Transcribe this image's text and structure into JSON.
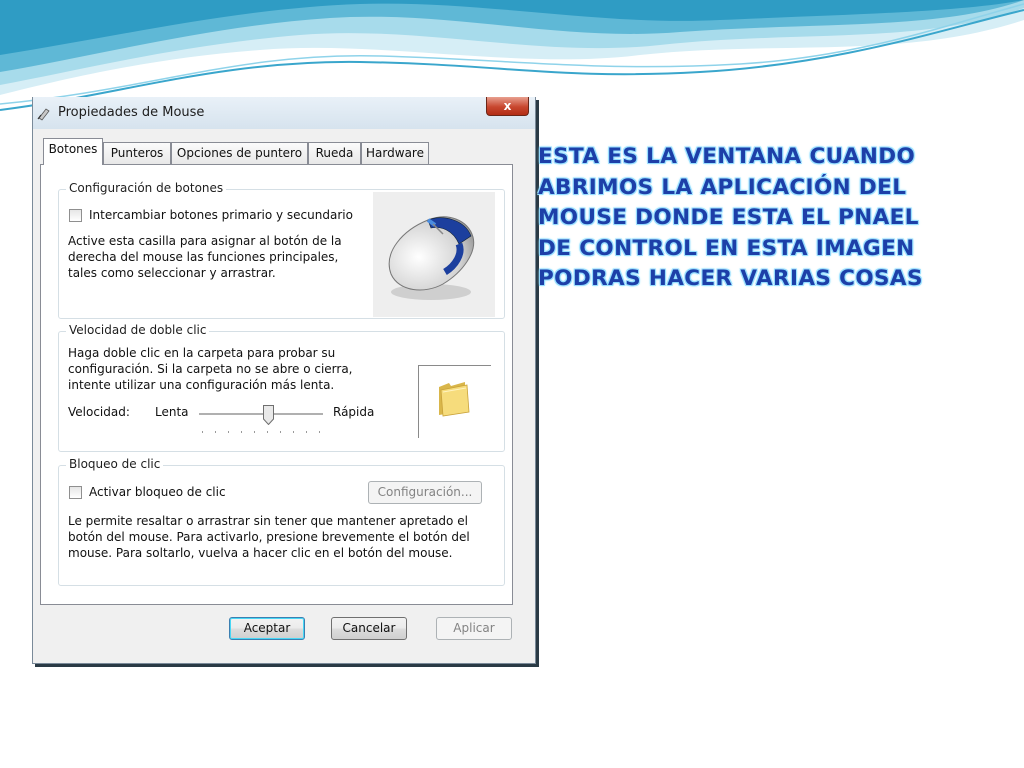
{
  "dialog": {
    "title": "Propiedades de Mouse",
    "close_label": "x",
    "tabs": [
      "Botones",
      "Punteros",
      "Opciones de puntero",
      "Rueda",
      "Hardware"
    ],
    "active_tab": "Botones"
  },
  "buttons_group": {
    "title": "Configuración de botones",
    "checkbox_label": "Intercambiar botones primario y secundario",
    "checkbox_checked": false,
    "description_lines": [
      "Active esta casilla para asignar al botón de la",
      "derecha del mouse las funciones principales,",
      "tales como seleccionar y arrastrar."
    ],
    "image_icon": "mouse-icon"
  },
  "doubleclick_group": {
    "title": "Velocidad de doble clic",
    "description_lines": [
      "Haga doble clic en la carpeta para probar su",
      "configuración. Si la carpeta no se abre o cierra,",
      "intente utilizar una configuración más lenta."
    ],
    "speed_label": "Velocidad:",
    "slow_label": "Lenta",
    "fast_label": "Rápida",
    "slider_fraction": 0.57,
    "image_icon": "folder-icon"
  },
  "clicklock_group": {
    "title": "Bloqueo de clic",
    "checkbox_label": "Activar bloqueo de clic",
    "checkbox_checked": false,
    "settings_button": "Configuración...",
    "description_lines": [
      "Le permite resaltar o arrastrar sin tener que mantener apretado el",
      "botón del mouse. Para activarlo, presione brevemente el botón del",
      "mouse. Para soltarlo, vuelva a hacer clic en el botón del mouse."
    ]
  },
  "footer": {
    "ok": "Aceptar",
    "cancel": "Cancelar",
    "apply": "Aplicar"
  },
  "caption": {
    "lines": [
      "ESTA ES LA VENTANA CUANDO",
      "ABRIMOS LA APLICACIÓN DEL",
      "MOUSE DONDE ESTA EL PNAEL",
      "DE CONTROL EN ESTA IMAGEN",
      "PODRAS HACER VARIAS COSAS"
    ],
    "color": "#1d3fa8"
  },
  "colors": {
    "wave_light": "#cdeaf4",
    "wave_mid": "#7cc8e0",
    "wave_dark": "#2a8fb8"
  }
}
